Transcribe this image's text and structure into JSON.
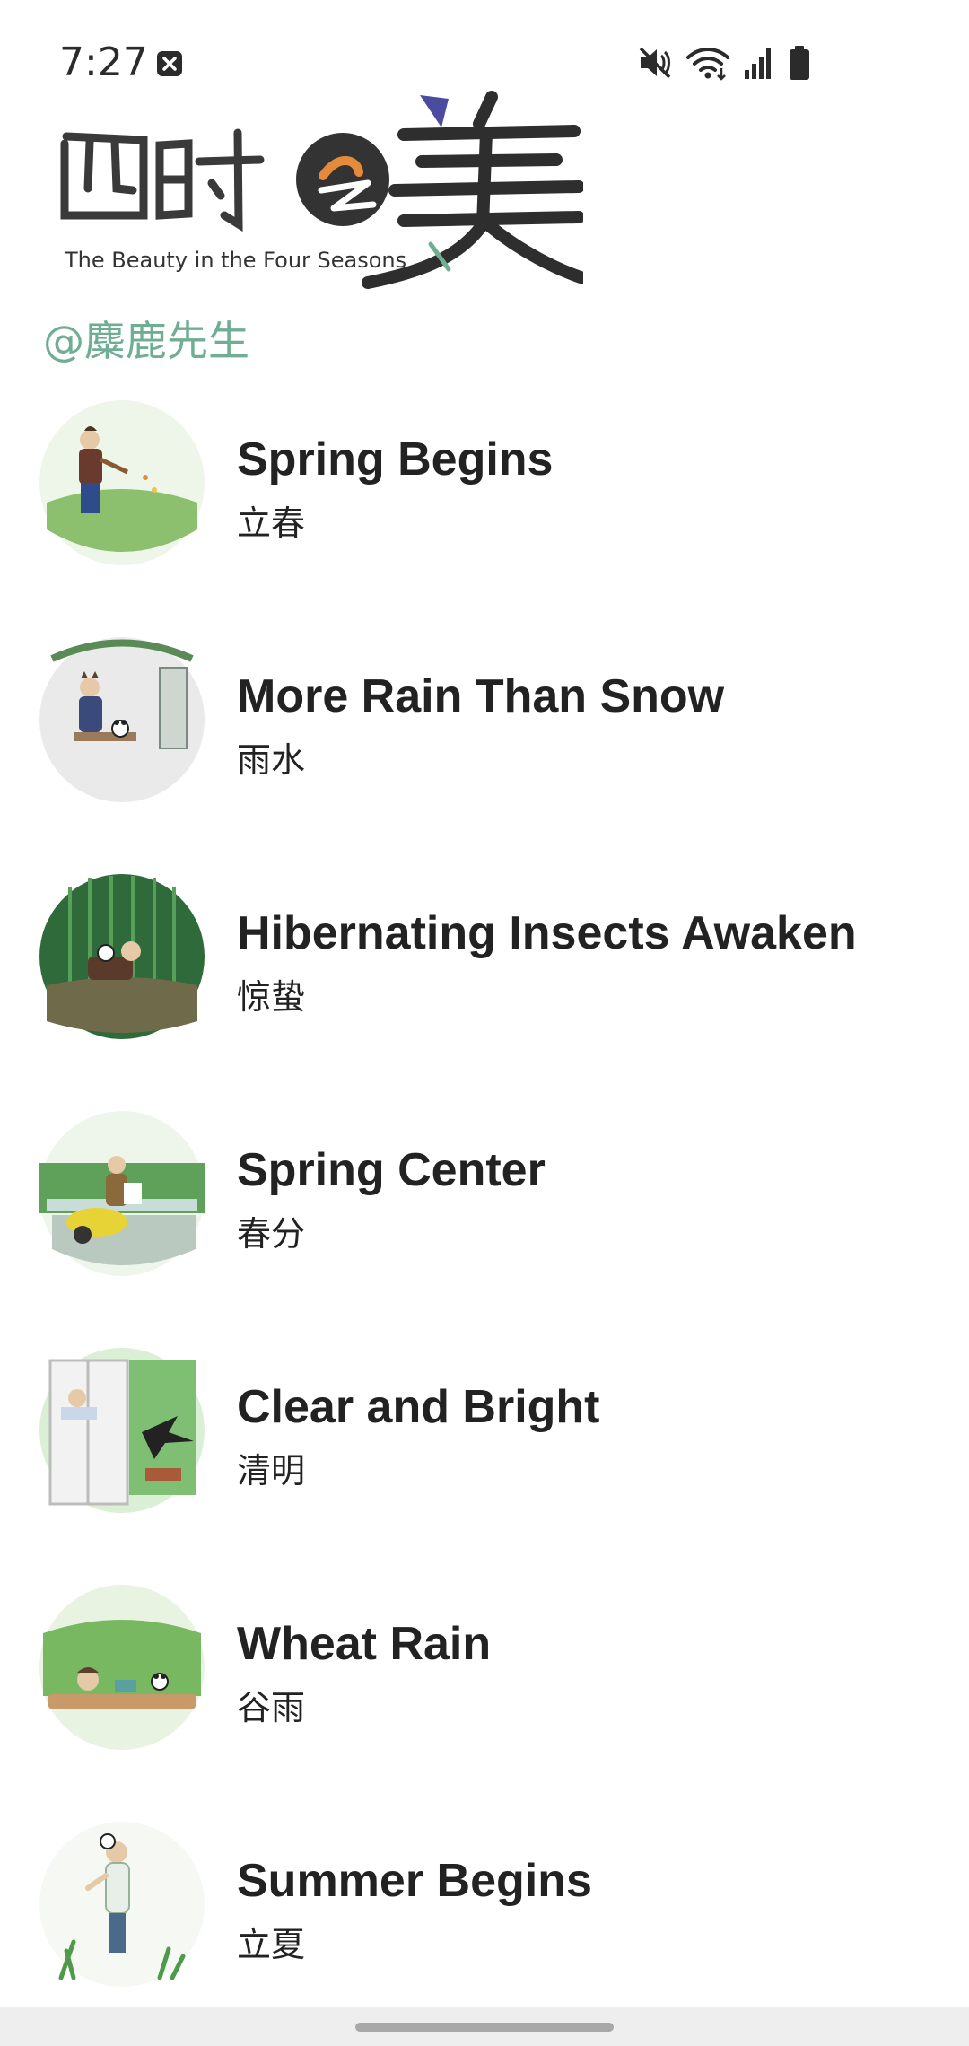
{
  "status_bar": {
    "time": "7:27",
    "icons": [
      "notification-dismiss-icon",
      "mute-icon",
      "wifi-icon",
      "signal-icon",
      "battery-icon"
    ]
  },
  "header": {
    "logo_text": "四时之美",
    "logo_subtitle": "The Beauty in the Four Seasons",
    "author": "@麋鹿先生"
  },
  "colors": {
    "author": "#6fae93",
    "title": "#222222",
    "accent_orange": "#e58a3a",
    "accent_purple": "#4b4ba0"
  },
  "items": [
    {
      "title": "Spring Begins",
      "subtitle": "立春"
    },
    {
      "title": "More Rain Than Snow",
      "subtitle": "雨水"
    },
    {
      "title": "Hibernating Insects Awaken",
      "subtitle": "惊蛰"
    },
    {
      "title": "Spring Center",
      "subtitle": "春分"
    },
    {
      "title": "Clear and Bright",
      "subtitle": "清明"
    },
    {
      "title": "Wheat Rain",
      "subtitle": "谷雨"
    },
    {
      "title": "Summer Begins",
      "subtitle": "立夏"
    }
  ]
}
